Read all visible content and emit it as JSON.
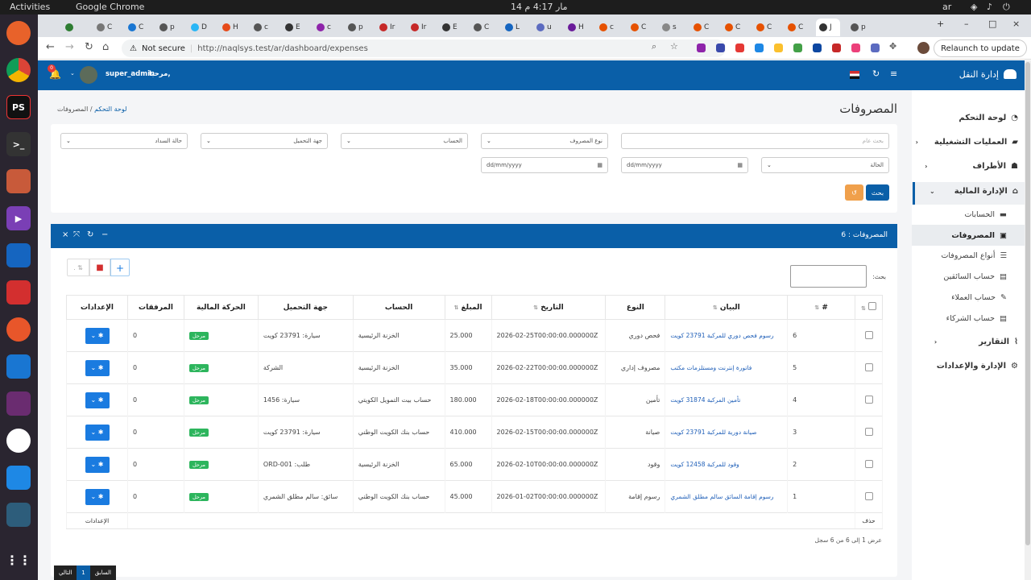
{
  "os": {
    "activities": "Activities",
    "app_name": "Google Chrome",
    "clock": "14 مار  4:17 م",
    "lang": "ar"
  },
  "browser": {
    "tabs_initials": [
      "",
      "C",
      "C",
      "p",
      "D",
      "H",
      "c",
      "E",
      "c",
      "p",
      "Ir",
      "Ir",
      "E",
      "C",
      "L",
      "u",
      "H",
      "c",
      "C",
      "s",
      "C",
      "C",
      "C",
      "C",
      "J",
      "p"
    ],
    "active_tab": "J",
    "not_secure": "Not secure",
    "url": "http://naqlsys.test/ar/dashboard/expenses",
    "relaunch": "Relaunch to update"
  },
  "header": {
    "brand": "إدارة النقل",
    "greeting": "مرحبا,",
    "username": "super_admin",
    "notif_count": "0"
  },
  "sidebar": {
    "items": [
      {
        "label": "لوحة التحكم",
        "icon": "dashboard-icon"
      },
      {
        "label": "العمليات التشغيلية",
        "icon": "truck-icon"
      },
      {
        "label": "الأطراف",
        "icon": "users-icon"
      },
      {
        "label": "الإدارة المالية",
        "icon": "finance-icon"
      }
    ],
    "finance_sub": [
      {
        "label": "الحسابات"
      },
      {
        "label": "المصروفات"
      },
      {
        "label": "أنواع المصروفات"
      },
      {
        "label": "حساب السائقين"
      },
      {
        "label": "حساب العملاء"
      },
      {
        "label": "حساب الشركاء"
      }
    ],
    "bottom": [
      {
        "label": "التقارير"
      },
      {
        "label": "الإدارة والإعدادات"
      }
    ]
  },
  "page": {
    "title": "المصروفات",
    "breadcrumb_home": "لوحة التحكم",
    "breadcrumb_sep": "/",
    "breadcrumb_current": "المصروفات"
  },
  "filters": {
    "search_placeholder": "بحث عام",
    "expense_type": "نوع المصروف",
    "account": "الحساب",
    "load_party": "جهة التحميل",
    "payment_status": "حالة السداد",
    "status": "الحالة",
    "date_placeholder": "dd/mm/yyyy",
    "search_button": "بحث",
    "reset_icon": "↺"
  },
  "card": {
    "title": "المصروفات : 6",
    "search_label": "بحث:",
    "page_info": "عرض 1 إلى 6 من 6 سجل"
  },
  "table": {
    "headers": [
      "#",
      "البيان",
      "النوع",
      "التاريخ",
      "المبلغ",
      "الحساب",
      "جهة التحميل",
      "الحركة المالية",
      "المرفقات",
      "الإعدادات"
    ],
    "footer_delete": "حذف",
    "footer_settings": "الإعدادات",
    "badge_label": "مرحل",
    "rows": [
      {
        "id": "6",
        "desc": "رسوم فحص دوري للمركبة 23791 كويت",
        "type": "فحص دوري",
        "date": "2026-02-25T00:00:00.000000Z",
        "amount": "25.000",
        "account": "الخزنة الرئيسية",
        "party": "سيارة: 23791 كويت",
        "attachments": "0"
      },
      {
        "id": "5",
        "desc": "فاتورة إنترنت ومستلزمات مكتب",
        "type": "مصروف إداري",
        "date": "2026-02-22T00:00:00.000000Z",
        "amount": "35.000",
        "account": "الخزنة الرئيسية",
        "party": "الشركة",
        "attachments": "0"
      },
      {
        "id": "4",
        "desc": "تأمين المركبة 31874 كويت",
        "type": "تأمين",
        "date": "2026-02-18T00:00:00.000000Z",
        "amount": "180.000",
        "account": "حساب بيت التمويل الكويتي",
        "party": "سيارة: 1456",
        "attachments": "0"
      },
      {
        "id": "3",
        "desc": "صيانة دورية للمركبة 23791 كويت",
        "type": "صيانة",
        "date": "2026-02-15T00:00:00.000000Z",
        "amount": "410.000",
        "account": "حساب بنك الكويت الوطني",
        "party": "سيارة: 23791 كويت",
        "attachments": "0"
      },
      {
        "id": "2",
        "desc": "وقود للمركبة 12458 كويت",
        "type": "وقود",
        "date": "2026-02-10T00:00:00.000000Z",
        "amount": "65.000",
        "account": "الخزنة الرئيسية",
        "party": "طلب: ORD-001",
        "attachments": "0"
      },
      {
        "id": "1",
        "desc": "رسوم إقامة السائق سالم مطلق الشمري",
        "type": "رسوم إقامة",
        "date": "2026-01-02T00:00:00.000000Z",
        "amount": "45.000",
        "account": "حساب بنك الكويت الوطني",
        "party": "سائق: سالم مطلق الشمري",
        "attachments": "0"
      }
    ]
  },
  "pager": {
    "next": "التالي",
    "current": "1",
    "prev": "السابق"
  }
}
